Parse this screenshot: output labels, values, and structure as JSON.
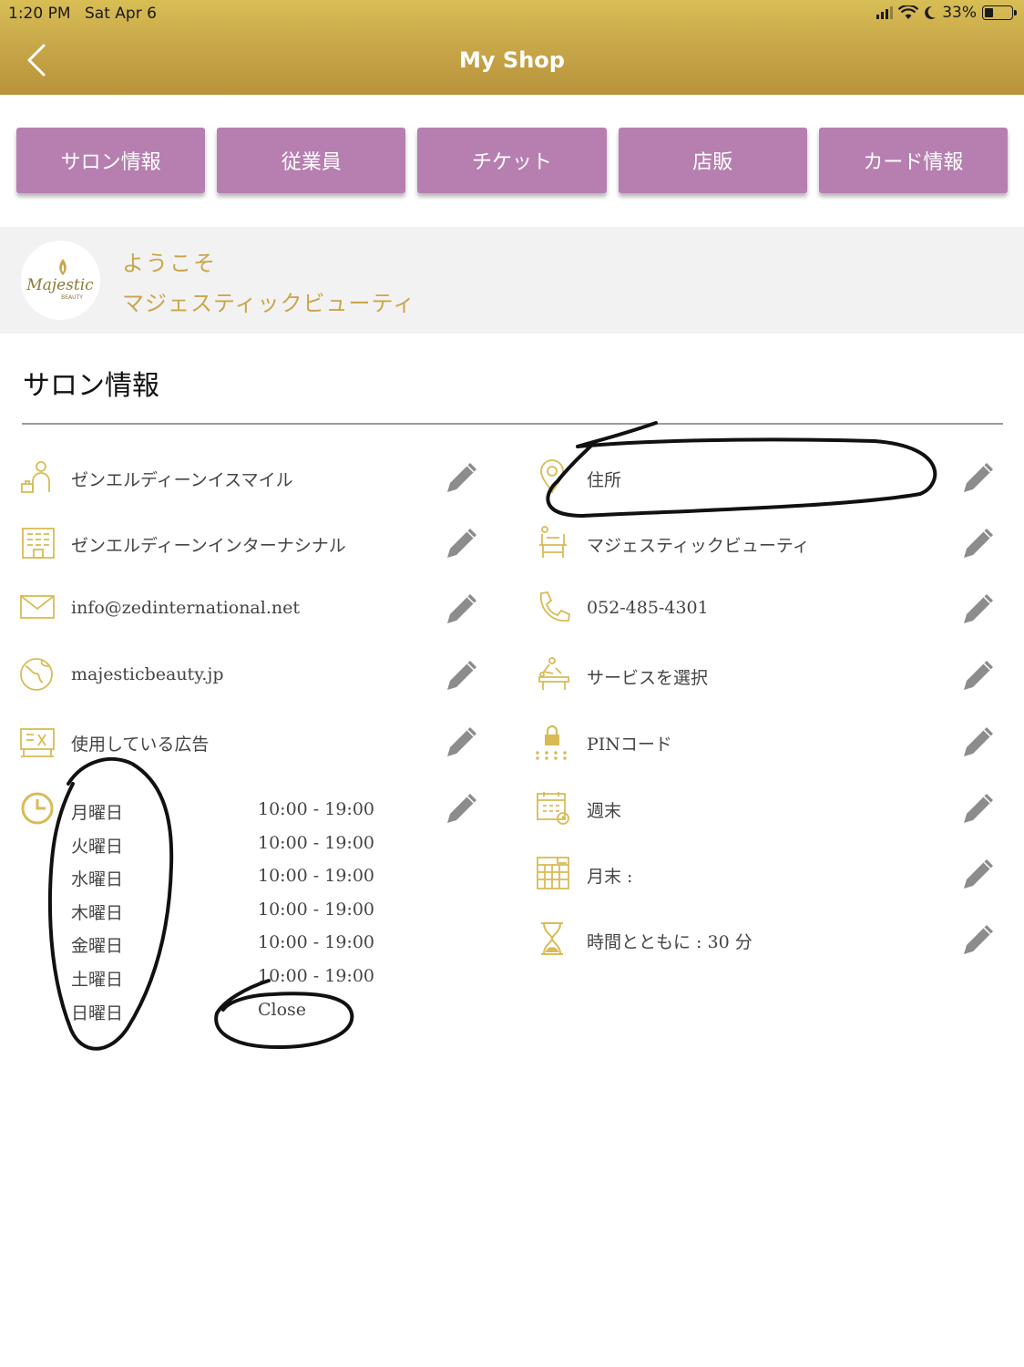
{
  "status_bar": {
    "time": "1:20 PM",
    "date": "Sat Apr 6",
    "battery": "33%"
  },
  "nav": {
    "title": "My Shop"
  },
  "tabs": [
    {
      "label": "サロン情報"
    },
    {
      "label": "従業員"
    },
    {
      "label": "チケット"
    },
    {
      "label": "店販"
    },
    {
      "label": "カード情報"
    }
  ],
  "welcome": {
    "greeting": "ようこそ",
    "shop_name": "マジェスティックビューティ",
    "logo_text": "Majestic",
    "logo_subtext": "BEAUTY"
  },
  "section": {
    "title": "サロン情報"
  },
  "left_items": [
    {
      "label": "ゼンエルディーンイスマイル",
      "icon": "person-icon"
    },
    {
      "label": "ゼンエルディーンインターナシナル",
      "icon": "building-icon"
    },
    {
      "label": "info@zedinternational.net",
      "icon": "envelope-icon"
    },
    {
      "label": "majesticbeauty.jp",
      "icon": "globe-icon"
    },
    {
      "label": "使用している広告",
      "icon": "billboard-icon"
    }
  ],
  "right_items": [
    {
      "label": "住所",
      "icon": "location-pin-icon"
    },
    {
      "label": "マジェスティックビューティ",
      "icon": "salon-chair-icon"
    },
    {
      "label": "052-485-4301",
      "icon": "phone-icon"
    },
    {
      "label": "サービスを選択",
      "icon": "massage-service-icon"
    },
    {
      "label": "PINコード",
      "icon": "lock-icon"
    },
    {
      "label": "週末",
      "icon": "calendar-week-icon"
    },
    {
      "label": "月末 :",
      "icon": "calendar-month-icon"
    },
    {
      "label": "時間とともに : 30 分",
      "icon": "hourglass-icon"
    }
  ],
  "hours": [
    {
      "day": "月曜日",
      "time": "10:00 - 19:00"
    },
    {
      "day": "火曜日",
      "time": "10:00 - 19:00"
    },
    {
      "day": "水曜日",
      "time": "10:00 - 19:00"
    },
    {
      "day": "木曜日",
      "time": "10:00 - 19:00"
    },
    {
      "day": "金曜日",
      "time": "10:00 - 19:00"
    },
    {
      "day": "土曜日",
      "time": "10:00 - 19:00"
    },
    {
      "day": "日曜日",
      "time": "Close"
    }
  ],
  "colors": {
    "gold": "#c9a64a",
    "tab_purple": "#b67fb0",
    "header_gold": "#c9a84a"
  }
}
